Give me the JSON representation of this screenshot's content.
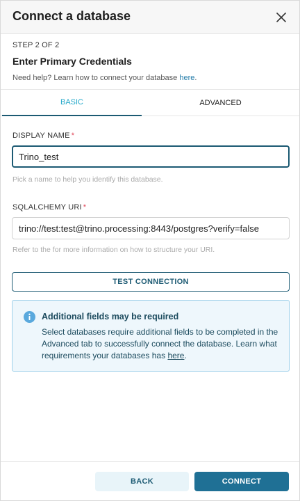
{
  "header": {
    "title": "Connect a database",
    "close_icon": "close-icon"
  },
  "step": {
    "label": "STEP 2 OF 2",
    "title": "Enter Primary Credentials",
    "help_text": "Need help? Learn how to connect your database ",
    "help_link": "here",
    "help_suffix": "."
  },
  "tabs": [
    {
      "label": "BASIC",
      "active": true
    },
    {
      "label": "ADVANCED",
      "active": false
    }
  ],
  "display_name": {
    "label": "DISPLAY NAME",
    "required_mark": "*",
    "value": "Trino_test",
    "hint": "Pick a name to help you identify this database."
  },
  "sqlalchemy_uri": {
    "label": "SQLALCHEMY URI",
    "required_mark": "*",
    "value": "trino://test:test@trino.processing:8443/postgres?verify=false",
    "hint": "Refer to the for more information on how to structure your URI."
  },
  "test_button": {
    "label": "TEST CONNECTION"
  },
  "alert": {
    "icon": "info-icon",
    "title": "Additional fields may be required",
    "body": "Select databases require additional fields to be completed in the Advanced tab to successfully connect the database. Learn what requirements your databases has ",
    "link": "here",
    "suffix": "."
  },
  "footer": {
    "back_label": "BACK",
    "connect_label": "CONNECT"
  },
  "colors": {
    "accent": "#1c5a73",
    "tab_active": "#20a7c9",
    "required": "#e04355",
    "alert_bg": "#eef7fc",
    "connect_bg": "#1f7095"
  }
}
